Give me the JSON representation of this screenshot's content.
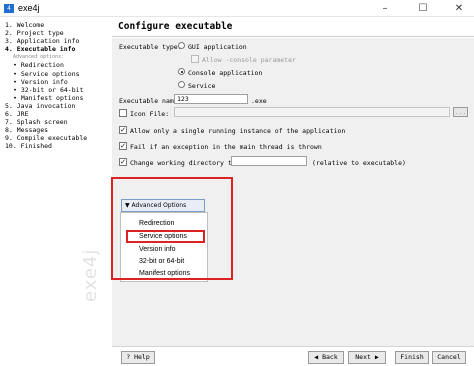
{
  "window": {
    "icon_text": "4",
    "title": "exe4j",
    "minimize": "–",
    "maximize": "☐",
    "close": "✕"
  },
  "sidebar": {
    "steps": [
      {
        "label": "1. Welcome"
      },
      {
        "label": "2. Project type"
      },
      {
        "label": "3. Application info"
      },
      {
        "label": "4. Executable info"
      },
      {
        "label": "Advanced options:"
      },
      {
        "label": "• Redirection"
      },
      {
        "label": "• Service options"
      },
      {
        "label": "• Version info"
      },
      {
        "label": "• 32-bit or 64-bit"
      },
      {
        "label": "• Manifest options"
      },
      {
        "label": "5. Java invocation"
      },
      {
        "label": "6. JRE"
      },
      {
        "label": "7. Splash screen"
      },
      {
        "label": "8. Messages"
      },
      {
        "label": "9. Compile executable"
      },
      {
        "label": "10. Finished"
      }
    ],
    "watermark": "exe4j"
  },
  "main": {
    "title": "Configure executable",
    "executable_type": {
      "label": "Executable type:",
      "options": [
        "GUI application",
        "Allow -console parameter",
        "Console application",
        "Service"
      ],
      "selected": "Console application"
    },
    "executable_name": {
      "label": "Executable name:",
      "value": "123",
      "suffix": ".exe"
    },
    "icon_file": {
      "label": "Icon File:",
      "value": "",
      "browse": "..."
    },
    "single_instance": {
      "label": "Allow only a single running instance of the application",
      "checked": true
    },
    "fail_exception": {
      "label": "Fail if an exception in the main thread is thrown",
      "checked": true
    },
    "change_dir": {
      "label": "Change working directory to:",
      "value": "",
      "hint": "(relative to executable)",
      "checked": true
    },
    "advanced": {
      "button_label": "Advanced Options",
      "menu_items": [
        "Redirection",
        "Service options",
        "Version info",
        "32-bit or 64-bit",
        "Manifest options"
      ],
      "highlighted": "32-bit or 64-bit"
    },
    "colors": {
      "highlight": "#dd2222",
      "accent": "#1f6fd0"
    }
  },
  "bottom_bar": {
    "help": "Help",
    "back": "Back",
    "next": "Next",
    "finish": "Finish",
    "cancel": "Cancel"
  }
}
